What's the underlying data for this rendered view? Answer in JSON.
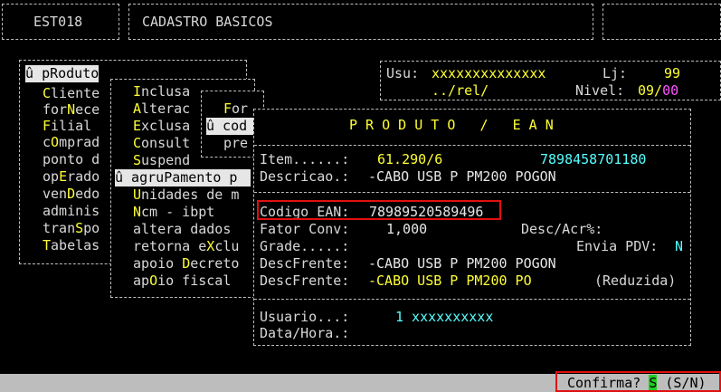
{
  "header": {
    "screen_code": "EST018",
    "screen_title": "CADASTRO BASICOS"
  },
  "user_info": {
    "usu_label": "Usu:",
    "usu_value": "xxxxxxxxxxxxxx",
    "lj_label": "Lj:",
    "lj_value": "99",
    "path": "../rel/",
    "nivel_label": "Nivel:",
    "nivel_value_a": "09/",
    "nivel_value_b": "00"
  },
  "main_menu": {
    "items": [
      {
        "prefix": "û ",
        "hot": "p",
        "label": "Roduto",
        "selected": true
      },
      {
        "pre": "",
        "hot": "C",
        "rest": "liente"
      },
      {
        "pre": "for",
        "hot": "N",
        "rest": "ece"
      },
      {
        "pre": "",
        "hot": "F",
        "rest": "ilial"
      },
      {
        "pre": "c",
        "hot": "O",
        "rest": "mprad"
      },
      {
        "pre": "ponto d",
        "hot": "",
        "rest": ""
      },
      {
        "pre": "op",
        "hot": "E",
        "rest": "rado"
      },
      {
        "pre": "ven",
        "hot": "D",
        "rest": "edo"
      },
      {
        "pre": "adminis",
        "hot": "",
        "rest": ""
      },
      {
        "pre": "tran",
        "hot": "S",
        "rest": "po"
      },
      {
        "pre": "",
        "hot": "T",
        "rest": "abelas"
      }
    ]
  },
  "sub_menu": {
    "items": [
      {
        "pre": "",
        "hot": "I",
        "rest": "nclusa"
      },
      {
        "pre": "",
        "hot": "A",
        "rest": "lterac"
      },
      {
        "pre": "",
        "hot": "E",
        "rest": "xclusa"
      },
      {
        "pre": "",
        "hot": "C",
        "rest": "onsult"
      },
      {
        "pre": "",
        "hot": "S",
        "rest": "uspend"
      },
      {
        "pre": "û agru",
        "hot": "P",
        "rest": "amento p",
        "selected": true
      },
      {
        "pre": "",
        "hot": "U",
        "rest": "nidades de m"
      },
      {
        "pre": "",
        "hot": "N",
        "rest": "cm - ibpt"
      },
      {
        "pre": "altera dados",
        "hot": "",
        "rest": ""
      },
      {
        "pre": "retorna e",
        "hot": "X",
        "rest": "clu"
      },
      {
        "pre": "apoio ",
        "hot": "D",
        "rest": "ecreto"
      },
      {
        "pre": "ap",
        "hot": "O",
        "rest": "io fiscal"
      }
    ]
  },
  "third_menu": {
    "items": [
      {
        "pre": "",
        "hot": "F",
        "rest": "or"
      },
      {
        "pre": "û cod",
        "hot": "",
        "rest": "",
        "selected": true
      },
      {
        "pre": "pre",
        "hot": "",
        "rest": ""
      }
    ]
  },
  "panel": {
    "title": "P R O D U T O   /   E A N",
    "item_label": "Item......:",
    "item_value": "61.290/6",
    "item_ean": "7898458701180",
    "descricao_label": "Descricao.:",
    "descricao_value": "-CABO USB P PM200 POGON",
    "codigo_ean_label": "Codigo EAN:",
    "codigo_ean_value": "78989520589496",
    "desc_acr_label": "Desc/Acr%:",
    "fator_label": "Fator Conv:",
    "fator_value": "1,000",
    "grade_label": "Grade.....:",
    "envia_pdv_label": "Envia PDV:",
    "envia_pdv_value": "N",
    "descfrente1_label": "DescFrente:",
    "descfrente1_value": "-CABO USB P PM200 POGON",
    "descfrente2_label": "DescFrente:",
    "descfrente2_value": "-CABO USB P PM200 PO",
    "reduzida_label": "(Reduzida)",
    "usuario_label": "Usuario...:",
    "usuario_value": "1 xxxxxxxxxx",
    "datahora_label": "Data/Hora.:"
  },
  "status": {
    "prompt": "Confirma?",
    "answer": "S",
    "options": "(S/N)"
  }
}
